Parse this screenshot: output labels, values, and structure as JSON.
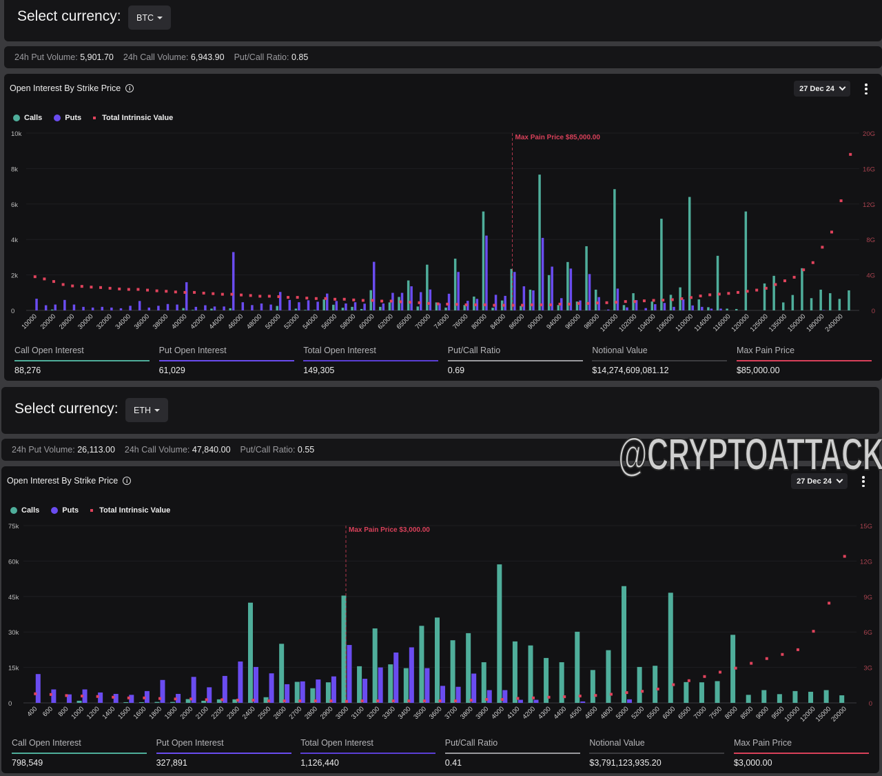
{
  "colors": {
    "calls": "#4fae9b",
    "puts": "#6a4cf0",
    "intrinsic": "#e0435c",
    "max_pain": "#d9415a",
    "total_oi": "#5b3fd6",
    "ratio": "#9a9a9e",
    "notional": "#3c3c40"
  },
  "sections": [
    {
      "currency_label": "Select currency:",
      "currency_value": "BTC",
      "stats": [
        {
          "label": "24h Put Volume:",
          "value": "5,901.70"
        },
        {
          "label": "24h Call Volume:",
          "value": "6,943.90"
        },
        {
          "label": "Put/Call Ratio:",
          "value": "0.85"
        }
      ],
      "chart_title": "Open Interest By Strike Price",
      "expiry": "27 Dec 24",
      "legend": {
        "calls": "Calls",
        "puts": "Puts",
        "intrinsic": "Total Intrinsic Value"
      },
      "footer": [
        {
          "label": "Call Open Interest",
          "value": "88,276"
        },
        {
          "label": "Put Open Interest",
          "value": "61,029"
        },
        {
          "label": "Total Open Interest",
          "value": "149,305"
        },
        {
          "label": "Put/Call Ratio",
          "value": "0.69"
        },
        {
          "label": "Notional Value",
          "value": "$14,274,609,081.12"
        },
        {
          "label": "Max Pain Price",
          "value": "$85,000.00"
        }
      ]
    },
    {
      "currency_label": "Select currency:",
      "currency_value": "ETH",
      "stats": [
        {
          "label": "24h Put Volume:",
          "value": "26,113.00"
        },
        {
          "label": "24h Call Volume:",
          "value": "47,840.00"
        },
        {
          "label": "Put/Call Ratio:",
          "value": "0.55"
        }
      ],
      "chart_title": "Open Interest By Strike Price",
      "expiry": "27 Dec 24",
      "legend": {
        "calls": "Calls",
        "puts": "Puts",
        "intrinsic": "Total Intrinsic Value"
      },
      "footer": [
        {
          "label": "Call Open Interest",
          "value": "798,549"
        },
        {
          "label": "Put Open Interest",
          "value": "327,891"
        },
        {
          "label": "Total Open Interest",
          "value": "1,126,440"
        },
        {
          "label": "Put/Call Ratio",
          "value": "0.41"
        },
        {
          "label": "Notional Value",
          "value": "$3,791,123,935.20"
        },
        {
          "label": "Max Pain Price",
          "value": "$3,000.00"
        }
      ]
    }
  ],
  "watermark": "@CRYPTOATTACK",
  "chart_data": [
    {
      "type": "bar",
      "title": "Open Interest By Strike Price",
      "x_tick_labels": [
        "10000",
        "",
        "20000",
        "",
        "28000",
        "",
        "30000",
        "",
        "32000",
        "",
        "34000",
        "",
        "36000",
        "",
        "38000",
        "",
        "40000",
        "",
        "42000",
        "",
        "44000",
        "",
        "46000",
        "",
        "48000",
        "",
        "50000",
        "",
        "52000",
        "",
        "54000",
        "",
        "56000",
        "",
        "58000",
        "",
        "60000",
        "",
        "62000",
        "",
        "65000",
        "",
        "70000",
        "",
        "74000",
        "",
        "76000",
        "",
        "80000",
        "",
        "84000",
        "",
        "86000",
        "",
        "90000",
        "",
        "94000",
        "",
        "96000",
        "",
        "98000",
        "",
        "100000",
        "",
        "102000",
        "",
        "104000",
        "",
        "106000",
        "",
        "110000",
        "",
        "114000",
        "",
        "116000",
        "",
        "120000",
        "",
        "125000",
        "",
        "135000",
        "",
        "150000",
        "",
        "180000",
        "",
        "240000",
        ""
      ],
      "y_ticks": [
        "0",
        "2k",
        "4k",
        "6k",
        "8k",
        "10k"
      ],
      "ylim": [
        0,
        10000
      ],
      "y2_ticks": [
        "0",
        "4G",
        "8G",
        "12G",
        "16G",
        "20G"
      ],
      "y2lim": [
        0,
        20
      ],
      "grid": true,
      "legend_position": "top-left",
      "max_pain": {
        "label": "Max Pain Price $85,000.00",
        "index": 51
      },
      "series": [
        {
          "name": "Calls",
          "axis": "left",
          "values": [
            0,
            0,
            50,
            0,
            0,
            0,
            0,
            0,
            0,
            0,
            0,
            0,
            0,
            0,
            0,
            0,
            130,
            30,
            0,
            100,
            0,
            120,
            0,
            0,
            0,
            0,
            250,
            0,
            100,
            30,
            30,
            620,
            320,
            150,
            200,
            80,
            1140,
            200,
            450,
            760,
            1690,
            220,
            2580,
            450,
            160,
            2920,
            300,
            780,
            5580,
            150,
            560,
            2340,
            250,
            1170,
            7660,
            1990,
            300,
            2730,
            500,
            3620,
            1170,
            10,
            6840,
            300,
            970,
            0,
            500,
            5170,
            880,
            1300,
            6400,
            620,
            180,
            3080,
            100,
            80,
            5580,
            0,
            1520,
            1950,
            450,
            870,
            2380,
            690,
            1170,
            970,
            650,
            1130
          ]
        },
        {
          "name": "Puts",
          "axis": "left",
          "values": [
            660,
            290,
            330,
            590,
            330,
            200,
            160,
            200,
            160,
            120,
            260,
            530,
            160,
            260,
            360,
            330,
            1590,
            200,
            290,
            220,
            220,
            3290,
            460,
            300,
            390,
            330,
            1040,
            590,
            460,
            570,
            490,
            950,
            530,
            390,
            460,
            380,
            2740,
            390,
            990,
            990,
            1360,
            1030,
            1180,
            400,
            940,
            2170,
            540,
            650,
            4220,
            880,
            820,
            2170,
            1360,
            1130,
            4090,
            2470,
            690,
            2360,
            560,
            2050,
            750,
            50,
            1230,
            170,
            580,
            130,
            350,
            420,
            200,
            620,
            280,
            200,
            100,
            100,
            0,
            0,
            0,
            0,
            0,
            0,
            0,
            0,
            0,
            0,
            20,
            0,
            0,
            0
          ]
        },
        {
          "name": "Total Intrinsic Value",
          "axis": "right",
          "unit": "G",
          "values": [
            3.8,
            3.55,
            3.26,
            2.92,
            2.76,
            2.71,
            2.63,
            2.58,
            2.5,
            2.42,
            2.37,
            2.37,
            2.29,
            2.21,
            2.16,
            2.08,
            2.03,
            2.03,
            1.95,
            1.89,
            1.82,
            1.82,
            1.74,
            1.68,
            1.6,
            1.6,
            1.55,
            1.47,
            1.47,
            1.39,
            1.34,
            1.34,
            1.26,
            1.26,
            1.18,
            1.13,
            1.13,
            1.05,
            1.05,
            0.97,
            0.92,
            0.87,
            0.79,
            0.74,
            0.71,
            0.68,
            0.63,
            0.63,
            0.63,
            0.58,
            0.58,
            0.58,
            0.58,
            0.63,
            0.63,
            0.63,
            0.71,
            0.71,
            0.79,
            0.79,
            0.84,
            0.87,
            0.92,
            1.0,
            1.0,
            1.08,
            1.13,
            1.16,
            1.21,
            1.32,
            1.45,
            1.63,
            1.76,
            1.84,
            1.92,
            2.03,
            2.16,
            2.29,
            2.5,
            2.92,
            3.34,
            3.74,
            4.58,
            5.39,
            7.13,
            8.84,
            12.37,
            17.6
          ]
        }
      ]
    },
    {
      "type": "bar",
      "title": "Open Interest By Strike Price",
      "x_tick_labels": [
        "400",
        "600",
        "800",
        "1000",
        "1200",
        "1400",
        "1500",
        "1600",
        "1800",
        "1900",
        "2000",
        "2100",
        "2200",
        "2300",
        "2400",
        "2500",
        "2600",
        "2700",
        "2800",
        "2900",
        "3000",
        "3100",
        "3200",
        "3300",
        "3400",
        "3500",
        "3600",
        "3700",
        "3800",
        "3900",
        "4000",
        "4100",
        "4200",
        "4300",
        "4400",
        "4500",
        "4600",
        "4800",
        "5000",
        "5200",
        "5500",
        "6000",
        "6500",
        "7000",
        "7500",
        "8000",
        "8500",
        "9000",
        "9500",
        "10000",
        "12000",
        "15000",
        "20000"
      ],
      "y_ticks": [
        "0",
        "15k",
        "30k",
        "45k",
        "60k",
        "75k"
      ],
      "ylim": [
        0,
        75000
      ],
      "y2_ticks": [
        "0",
        "3G",
        "6G",
        "9G",
        "12G",
        "15G"
      ],
      "y2lim": [
        0,
        15
      ],
      "grid": true,
      "legend_position": "top-left",
      "max_pain": {
        "label": "Max Pain Price $3,000.00",
        "index": 20
      },
      "series": [
        {
          "name": "Calls",
          "axis": "left",
          "values": [
            0,
            0,
            0,
            900,
            0,
            0,
            300,
            300,
            400,
            400,
            1600,
            900,
            1500,
            1500,
            42400,
            2400,
            25000,
            8900,
            6200,
            8700,
            45400,
            15500,
            31500,
            16300,
            14700,
            32600,
            36100,
            26500,
            29500,
            17200,
            58600,
            26000,
            24300,
            19000,
            17200,
            30100,
            13900,
            22300,
            49400,
            15200,
            15700,
            46600,
            8800,
            8700,
            9200,
            28800,
            3400,
            5400,
            3700,
            5000,
            4700,
            5400,
            3200
          ]
        },
        {
          "name": "Puts",
          "axis": "left",
          "values": [
            12200,
            5700,
            3600,
            5700,
            4400,
            3800,
            3400,
            5000,
            9700,
            3800,
            11000,
            6600,
            11400,
            17500,
            15200,
            12500,
            7900,
            9100,
            9900,
            11200,
            24500,
            10200,
            15000,
            21300,
            23500,
            14700,
            7200,
            6800,
            12400,
            5400,
            5400,
            1300,
            1300,
            0,
            0,
            600,
            0,
            0,
            1500,
            0,
            0,
            0,
            0,
            0,
            0,
            0,
            0,
            0,
            0,
            0,
            0,
            0,
            0
          ]
        },
        {
          "name": "Total Intrinsic Value",
          "axis": "right",
          "unit": "G",
          "values": [
            0.77,
            0.71,
            0.62,
            0.58,
            0.54,
            0.48,
            0.42,
            0.42,
            0.37,
            0.33,
            0.33,
            0.27,
            0.27,
            0.23,
            0.23,
            0.17,
            0.17,
            0.17,
            0.17,
            0.17,
            0.13,
            0.17,
            0.17,
            0.17,
            0.17,
            0.17,
            0.17,
            0.17,
            0.23,
            0.29,
            0.29,
            0.38,
            0.42,
            0.48,
            0.52,
            0.58,
            0.63,
            0.73,
            0.87,
            0.98,
            1.17,
            1.54,
            1.88,
            2.23,
            2.6,
            2.94,
            3.35,
            3.75,
            4.1,
            4.5,
            6.06,
            8.44,
            12.4
          ]
        }
      ]
    }
  ]
}
